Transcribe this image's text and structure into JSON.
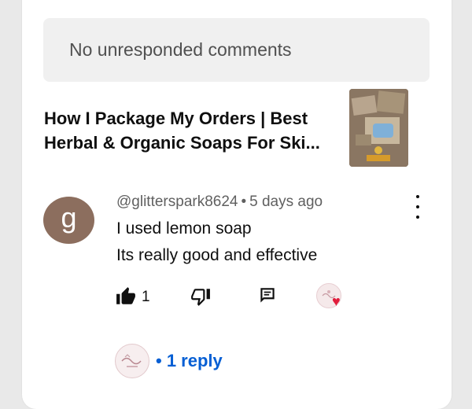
{
  "banner": {
    "text": "No unresponded comments"
  },
  "video": {
    "title": "How I Package My Orders | Best Herbal & Organic Soaps For Ski..."
  },
  "comment": {
    "avatar_letter": "g",
    "author": "@glitterspark8624",
    "separator": "•",
    "time": "5 days ago",
    "lines": [
      "I used lemon soap",
      "Its really good and effective"
    ],
    "likes": "1"
  },
  "replies": {
    "label": "• 1 reply"
  },
  "colors": {
    "link": "#065fd4",
    "avatar_bg": "#8c6e5e",
    "heart": "#e11d3c"
  },
  "icons": {
    "like": "thumbs-up-filled-icon",
    "dislike": "thumbs-down-outline-icon",
    "reply": "comment-reply-icon",
    "menu": "more-vertical-icon",
    "creator_heart": "heart-icon"
  }
}
